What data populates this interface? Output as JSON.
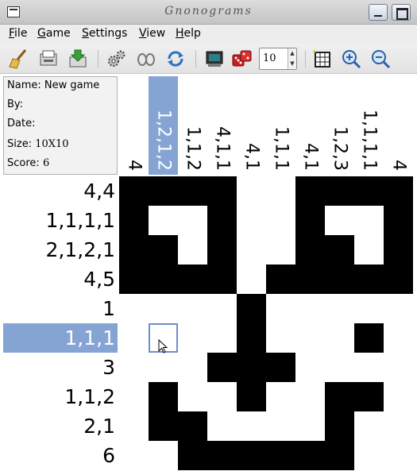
{
  "window": {
    "title": "Gnonograms"
  },
  "menu": [
    "File",
    "Game",
    "Settings",
    "View",
    "Help"
  ],
  "toolbar": {
    "icons": [
      "clear-broom-icon",
      "load-game-icon",
      "save-game-icon",
      "settings-gears-icon",
      "hint-glasses-icon",
      "restart-refresh-icon",
      "computer-solve-icon",
      "random-dice-icon",
      "grid-size-spinner",
      "toggle-grid-icon",
      "zoom-in-icon",
      "zoom-out-icon"
    ],
    "grid_size_value": "10"
  },
  "info": {
    "name": "Name: New game",
    "by": "By:",
    "date": "Date:",
    "size_label": "Size:",
    "size_value": "10X10",
    "score_label": "Score:",
    "score_value": "6"
  },
  "column_clues": [
    "4",
    "1,2,1,2",
    "1,1,2",
    "4,1,1",
    "4,1",
    "1,1,1",
    "4,1",
    "1,2,3",
    "1,1,1,1",
    "4"
  ],
  "row_clues": [
    "4,4",
    "1,1,1,1",
    "2,1,2,1",
    "4,5",
    "1",
    "1,1,1",
    "3",
    "1,1,2",
    "2,1",
    "6"
  ],
  "highlight": {
    "row": 5,
    "col": 1
  },
  "grid": [
    [
      1,
      1,
      1,
      1,
      0,
      0,
      1,
      1,
      1,
      1
    ],
    [
      1,
      0,
      0,
      1,
      0,
      0,
      1,
      0,
      0,
      1
    ],
    [
      1,
      1,
      0,
      1,
      0,
      0,
      1,
      1,
      0,
      1
    ],
    [
      1,
      1,
      1,
      1,
      0,
      1,
      1,
      1,
      1,
      1
    ],
    [
      0,
      0,
      0,
      0,
      1,
      0,
      0,
      0,
      0,
      0
    ],
    [
      0,
      0,
      0,
      0,
      1,
      0,
      0,
      0,
      1,
      0
    ],
    [
      0,
      0,
      0,
      1,
      1,
      1,
      0,
      0,
      0,
      0
    ],
    [
      0,
      1,
      0,
      0,
      1,
      0,
      0,
      1,
      1,
      0
    ],
    [
      0,
      1,
      1,
      0,
      0,
      0,
      0,
      1,
      0,
      0
    ],
    [
      0,
      0,
      1,
      1,
      1,
      1,
      1,
      1,
      0,
      0
    ]
  ],
  "colors": {
    "highlight": "#85a4d4",
    "filled": "#000000",
    "empty": "#ffffff"
  }
}
